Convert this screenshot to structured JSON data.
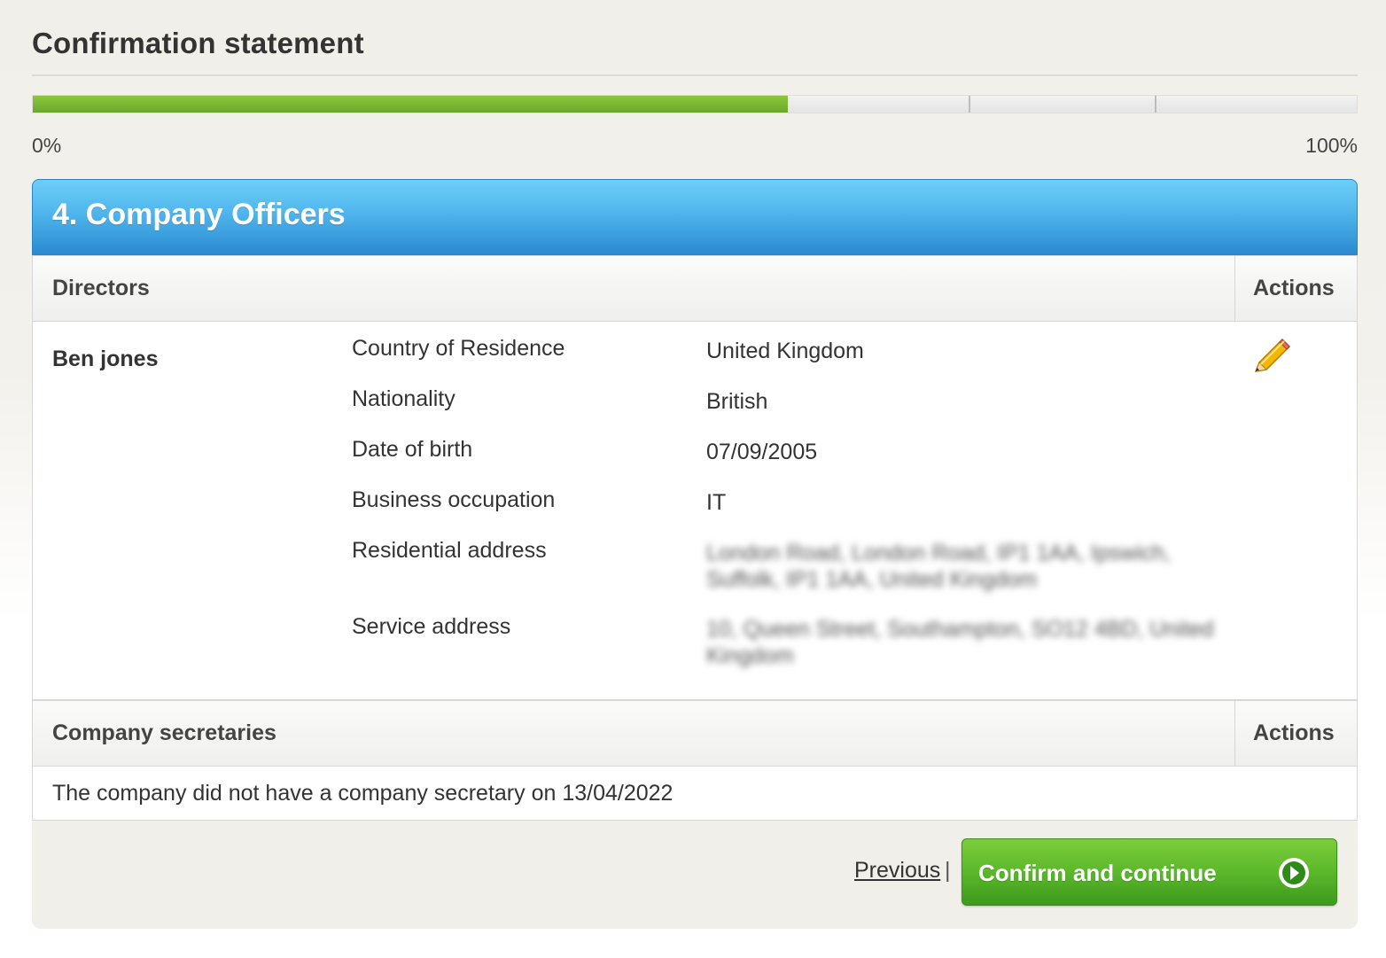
{
  "page": {
    "title": "Confirmation statement"
  },
  "progress": {
    "percent_complete": 57,
    "min_label": "0%",
    "max_label": "100%",
    "fill_color": "#7ab83a"
  },
  "step": {
    "title": "4. Company Officers",
    "header_color": "#3fa4e4"
  },
  "directors": {
    "heading": "Directors",
    "actions_label": "Actions",
    "officer": {
      "name": "Ben jones",
      "fields": [
        {
          "label": "Country of Residence",
          "value": "United Kingdom"
        },
        {
          "label": "Nationality",
          "value": "British"
        },
        {
          "label": "Date of birth",
          "value": "07/09/2005"
        },
        {
          "label": "Business occupation",
          "value": "IT"
        },
        {
          "label": "Residential address",
          "value": "London Road, London Road, IP1 1AA, Ipswich, Suffolk, IP1 1AA, United Kingdom"
        },
        {
          "label": "Service address",
          "value": "10, Queen Street, Southampton, SO12 4BD, United Kingdom"
        }
      ],
      "edit_icon": "pencil-icon"
    }
  },
  "secretaries": {
    "heading": "Company secretaries",
    "actions_label": "Actions",
    "note": "The company did not have a company secretary on 13/04/2022"
  },
  "footer": {
    "previous_label": "Previous",
    "separator": "|",
    "confirm_label": "Confirm and continue",
    "confirm_icon": "arrow-right-circle-icon",
    "confirm_color": "#5bb82a"
  }
}
